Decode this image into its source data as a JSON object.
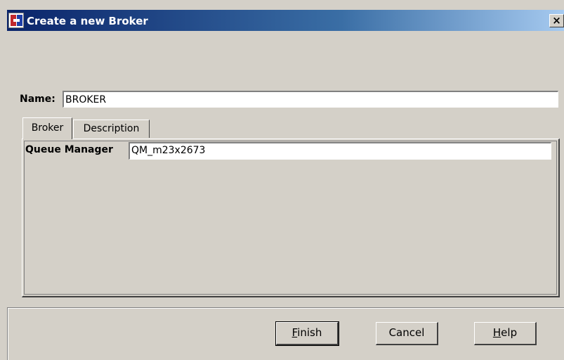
{
  "window": {
    "title": "Create a new Broker",
    "close_glyph": "✕"
  },
  "name_field": {
    "label": "Name:",
    "value": "BROKER"
  },
  "tabs": [
    {
      "label": "Broker",
      "selected": true
    },
    {
      "label": "Description",
      "selected": false
    }
  ],
  "broker_tab": {
    "queue_manager_label": "Queue Manager",
    "queue_manager_value": "QM_m23x2673"
  },
  "buttons": {
    "finish": {
      "mnemonic": "F",
      "rest": "inish"
    },
    "cancel": "Cancel",
    "help": {
      "mnemonic": "H",
      "rest": "elp"
    }
  },
  "icons": {
    "app": "broker-app-icon",
    "close": "close-icon"
  }
}
